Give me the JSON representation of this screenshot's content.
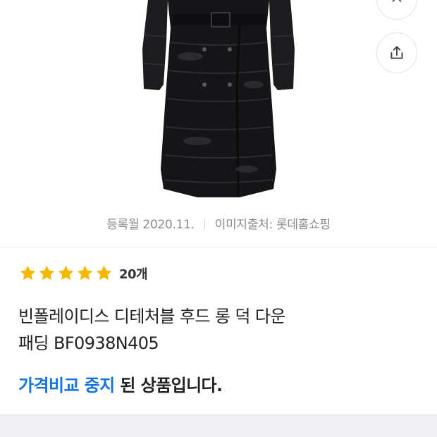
{
  "product": {
    "meta": {
      "registered": "등록월 2020.11.",
      "image_source": "이미지출처: 롯데홈쇼핑"
    },
    "rating": {
      "stars": 5,
      "star_color": "#f5b800",
      "count_label": "20개"
    },
    "title_line1": "빈폴레이디스 디테처블 후드 롱 덕 다운",
    "title_line2": "패딩 BF0938N405",
    "status": {
      "highlight": "가격비교 중지",
      "rest": " 된 상품입니다.",
      "highlight_color": "#1273e4"
    }
  },
  "actions": {
    "top_icon": "chevron-up-icon",
    "share_icon": "share-icon"
  }
}
